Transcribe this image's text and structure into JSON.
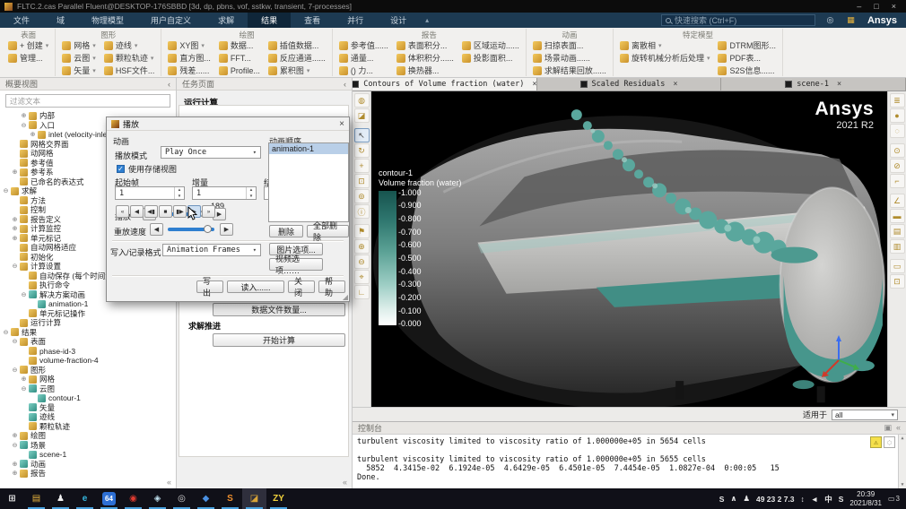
{
  "titlebar": {
    "title": "FLTC.2.cas Parallel Fluent@DESKTOP-176SBBD  [3d, dp, pbns, vof, sstkw, transient, 7-processes]",
    "minimize": "–",
    "maximize": "□",
    "close": "×"
  },
  "menubar": {
    "tabs": [
      {
        "label": "文件"
      },
      {
        "label": "域"
      },
      {
        "label": "物理模型"
      },
      {
        "label": "用户自定义"
      },
      {
        "label": "求解"
      },
      {
        "label": "结果",
        "active": true
      },
      {
        "label": "查看"
      },
      {
        "label": "并行"
      },
      {
        "label": "设计"
      }
    ],
    "collapse_icon": "▴",
    "search_placeholder": "快速搜索 (Ctrl+F)",
    "help_icon": "◎",
    "apps_icon": "▦",
    "brand": "Ansys"
  },
  "ribbon": {
    "groups": [
      {
        "title": "表面",
        "columns": [
          [
            {
              "label": "+ 创建",
              "icon": "create-surface",
              "caret": true
            },
            {
              "label": "管理...",
              "icon": "manage-surfaces"
            }
          ]
        ]
      },
      {
        "title": "图形",
        "columns": [
          [
            {
              "label": "网格",
              "icon": "mesh-display",
              "caret": true
            },
            {
              "label": "云图",
              "icon": "contours",
              "caret": true
            },
            {
              "label": "矢量",
              "icon": "vectors",
              "caret": true
            }
          ],
          [
            {
              "label": "迹线",
              "icon": "pathlines",
              "caret": true
            },
            {
              "label": "颗粒轨迹",
              "icon": "particle-tracks",
              "caret": true
            },
            {
              "label": "HSF文件...",
              "icon": "hsf-file"
            }
          ]
        ]
      },
      {
        "title": "绘图",
        "columns": [
          [
            {
              "label": "XY图",
              "icon": "xy-plot",
              "caret": true
            },
            {
              "label": "直方图...",
              "icon": "histogram"
            },
            {
              "label": "残差......",
              "icon": "residuals"
            }
          ],
          [
            {
              "label": "数据...",
              "icon": "data-sources"
            },
            {
              "label": "FFT...",
              "icon": "fft"
            },
            {
              "label": "Profile...",
              "icon": "profile-data"
            }
          ],
          [
            {
              "label": "插值数据...",
              "icon": "interpolated-data"
            },
            {
              "label": "反应通道......",
              "icon": "reaction-pathways"
            },
            {
              "label": "累积图",
              "icon": "cumulative-plot",
              "caret": true
            }
          ]
        ]
      },
      {
        "title": "报告",
        "columns": [
          [
            {
              "label": "参考值......",
              "icon": "reference-values"
            },
            {
              "label": "通量...",
              "icon": "fluxes"
            },
            {
              "label": "() 力...",
              "icon": "forces"
            }
          ],
          [
            {
              "label": "表面积分...",
              "icon": "surface-integrals"
            },
            {
              "label": "体积积分......",
              "icon": "volume-integrals"
            },
            {
              "label": "换热器...",
              "icon": "heat-exchanger"
            }
          ],
          [
            {
              "label": "区域运动......",
              "icon": "zone-motion"
            },
            {
              "label": "投影面积...",
              "icon": "projected-areas"
            }
          ]
        ]
      },
      {
        "title": "动画",
        "columns": [
          [
            {
              "label": "扫掠表面...",
              "icon": "sweep-surface"
            },
            {
              "label": "场景动画......",
              "icon": "scene-animation"
            },
            {
              "label": "求解结果回放......",
              "icon": "solution-playback"
            }
          ]
        ]
      },
      {
        "title": "特定模型",
        "columns": [
          [
            {
              "label": "离散相",
              "icon": "discrete-phase",
              "caret": true
            },
            {
              "label": "旋转机械分析后处理",
              "icon": "turbo-postprocessing",
              "caret": true
            }
          ],
          [
            {
              "label": "DTRM图形...",
              "icon": "dtrm-graphics"
            },
            {
              "label": "PDF表...",
              "icon": "pdf-tables"
            },
            {
              "label": "S2S信息......",
              "icon": "s2s-info"
            }
          ]
        ]
      }
    ]
  },
  "outline": {
    "header": "概要视图",
    "collapse": "‹",
    "filter_placeholder": "过滤文本",
    "scroll_hint": "«",
    "items": [
      {
        "label": "内部",
        "depth": 2,
        "expand": "+",
        "icon": "internal-zone"
      },
      {
        "label": "入口",
        "depth": 2,
        "expand": "-",
        "icon": "inlet-zone"
      },
      {
        "label": "inlet (velocity-inlet...",
        "depth": 3,
        "expand": "+",
        "icon": "velocity-inlet"
      },
      {
        "label": "网格交界面",
        "depth": 1,
        "expand": "",
        "icon": "mesh-interfaces"
      },
      {
        "label": "动网格",
        "depth": 1,
        "expand": "",
        "icon": "dynamic-mesh"
      },
      {
        "label": "参考值",
        "depth": 1,
        "expand": "",
        "icon": "reference-values"
      },
      {
        "label": "参考系",
        "depth": 1,
        "expand": "+",
        "icon": "reference-frames"
      },
      {
        "label": "已命名的表达式",
        "depth": 1,
        "expand": "",
        "icon": "named-expressions"
      },
      {
        "label": "求解",
        "depth": 0,
        "expand": "-",
        "icon": "solution"
      },
      {
        "label": "方法",
        "depth": 1,
        "expand": "",
        "icon": "methods"
      },
      {
        "label": "控制",
        "depth": 1,
        "expand": "",
        "icon": "controls"
      },
      {
        "label": "报告定义",
        "depth": 1,
        "expand": "+",
        "icon": "report-definitions"
      },
      {
        "label": "计算监控",
        "depth": 1,
        "expand": "+",
        "icon": "monitors"
      },
      {
        "label": "单元标记",
        "depth": 1,
        "expand": "+",
        "icon": "cell-registers"
      },
      {
        "label": "自动网格适应",
        "depth": 1,
        "expand": "",
        "icon": "mesh-adaption"
      },
      {
        "label": "初始化",
        "depth": 1,
        "expand": "",
        "icon": "initialization"
      },
      {
        "label": "计算设置",
        "depth": 1,
        "expand": "-",
        "icon": "calculation-activities"
      },
      {
        "label": "自动保存 (每个时间步)",
        "depth": 2,
        "expand": "",
        "icon": "autosave"
      },
      {
        "label": "执行命令",
        "depth": 2,
        "expand": "",
        "icon": "execute-commands"
      },
      {
        "label": "解决方案动画",
        "depth": 2,
        "expand": "-",
        "icon": "solution-animations"
      },
      {
        "label": "animation-1",
        "depth": 3,
        "expand": "",
        "icon": "animation-item"
      },
      {
        "label": "单元标记操作",
        "depth": 2,
        "expand": "",
        "icon": "register-operations"
      },
      {
        "label": "运行计算",
        "depth": 1,
        "expand": "",
        "icon": "run-calculation"
      },
      {
        "label": "结果",
        "depth": 0,
        "expand": "-",
        "icon": "results"
      },
      {
        "label": "表面",
        "depth": 1,
        "expand": "-",
        "icon": "surfaces"
      },
      {
        "label": "phase-id-3",
        "depth": 2,
        "expand": "",
        "icon": "surface-item"
      },
      {
        "label": "volume-fraction-4",
        "depth": 2,
        "expand": "",
        "icon": "surface-item"
      },
      {
        "label": "图形",
        "depth": 1,
        "expand": "-",
        "icon": "graphics-node"
      },
      {
        "label": "网格",
        "depth": 2,
        "expand": "+",
        "icon": "mesh-graphic"
      },
      {
        "label": "云图",
        "depth": 2,
        "expand": "-",
        "icon": "contours-node"
      },
      {
        "label": "contour-1",
        "depth": 3,
        "expand": "",
        "icon": "contour-item"
      },
      {
        "label": "矢量",
        "depth": 2,
        "expand": "",
        "icon": "vectors-node"
      },
      {
        "label": "迹线",
        "depth": 2,
        "expand": "",
        "icon": "pathlines-node"
      },
      {
        "label": "颗粒轨迹",
        "depth": 2,
        "expand": "",
        "icon": "particle-tracks-node"
      },
      {
        "label": "绘图",
        "depth": 1,
        "expand": "+",
        "icon": "plots-node"
      },
      {
        "label": "场景",
        "depth": 1,
        "expand": "-",
        "icon": "scenes-node"
      },
      {
        "label": "scene-1",
        "depth": 2,
        "expand": "",
        "icon": "scene-item"
      },
      {
        "label": "动画",
        "depth": 1,
        "expand": "+",
        "icon": "animations-node"
      },
      {
        "label": "报告",
        "depth": 1,
        "expand": "+",
        "icon": "reports-node"
      }
    ]
  },
  "taskpage": {
    "header": "任务页面",
    "collapse": "‹",
    "title": "运行计算",
    "data_file_button": "数据文件数量...",
    "advance_label": "求解推进",
    "calculate_button": "开始计算",
    "scroll_hint": "«"
  },
  "dialog": {
    "title": "播放",
    "close": "×",
    "section_animation": "动画",
    "playback_mode_label": "播放模式",
    "playback_mode_value": "Play Once",
    "use_stored_view": "使用存储视图",
    "check_glyph": "✓",
    "start_frame_label": "起始帧",
    "start_frame_value": "1",
    "increment_label": "增量",
    "increment_value": "1",
    "end_frame_label": "结束帧",
    "end_frame_value": "189",
    "play_label": "播放",
    "frame_value": "189",
    "slider_left": "◀",
    "slider_right": "▶",
    "transport": [
      {
        "name": "first-frame-button",
        "glyph": "«"
      },
      {
        "name": "play-reverse-button",
        "glyph": "◀"
      },
      {
        "name": "step-back-button",
        "glyph": "◀▮"
      },
      {
        "name": "stop-button",
        "glyph": "■"
      },
      {
        "name": "step-forward-button",
        "glyph": "▮▶"
      },
      {
        "name": "play-button",
        "glyph": "▶",
        "active": true
      },
      {
        "name": "last-frame-button",
        "glyph": "»"
      }
    ],
    "replay_speed_label": "重放速度",
    "write_format_label": "写入/记录格式",
    "write_format_value": "Animation Frames",
    "picture_options": "图片选项...",
    "video_options": "视频选项……",
    "sequences_label": "动画顺序",
    "sequences": [
      {
        "label": "animation-1",
        "active": true
      }
    ],
    "delete": "删除",
    "delete_all": "全部删除",
    "write": "写出",
    "read": "读入......",
    "close_btn": "关闭",
    "help": "帮助",
    "grip": "◢"
  },
  "graphics": {
    "tabs": [
      {
        "label": "Contours of Volume fraction (water)",
        "close": "×",
        "active": true
      },
      {
        "label": "Scaled Residuals",
        "close": "×"
      },
      {
        "label": "scene-1",
        "close": "×"
      }
    ],
    "left_toolbar": [
      {
        "name": "mesh-display-button",
        "glyph": "◍"
      },
      {
        "name": "clip-plane-button",
        "glyph": "◪"
      },
      {
        "name": "pointer-tool-button",
        "glyph": "↖",
        "active": true,
        "gap": true
      },
      {
        "name": "rotate-tool-button",
        "glyph": "↻"
      },
      {
        "name": "pan-tool-button",
        "glyph": "+"
      },
      {
        "name": "zoom-box-tool-button",
        "glyph": "⊡"
      },
      {
        "name": "probe-tool-button",
        "glyph": "⊚"
      },
      {
        "name": "info-button",
        "glyph": "ⓘ"
      },
      {
        "name": "render-button",
        "glyph": "⚑",
        "gap": true
      },
      {
        "name": "zoom-in-button",
        "glyph": "⊕"
      },
      {
        "name": "zoom-out-button",
        "glyph": "⊖"
      },
      {
        "name": "fit-view-button",
        "glyph": "⌖"
      },
      {
        "name": "axes-button",
        "glyph": "∟"
      }
    ],
    "right_toolbar": [
      {
        "name": "view-layers-button",
        "glyph": "≣"
      },
      {
        "name": "shaded-view-button",
        "glyph": "●"
      },
      {
        "name": "wireframe-view-button",
        "glyph": "◌"
      },
      {
        "name": "show-items-button",
        "glyph": "⊙",
        "gap": true
      },
      {
        "name": "hide-items-button",
        "glyph": "⊘"
      },
      {
        "name": "previous-view-button",
        "glyph": "⌐"
      },
      {
        "name": "axes-plot-button",
        "glyph": "∠",
        "gap": true
      },
      {
        "name": "highlight-button",
        "glyph": "▬"
      },
      {
        "name": "annotate-button",
        "glyph": "▤"
      },
      {
        "name": "report-view-button",
        "glyph": "▥"
      },
      {
        "name": "new-window-button",
        "glyph": "▭",
        "gap": true
      },
      {
        "name": "embedded-window-button",
        "glyph": "⊡"
      }
    ],
    "legend": {
      "name": "contour-1",
      "title": "Volume fraction (water)",
      "ticks": [
        "1.000",
        "0.900",
        "0.800",
        "0.700",
        "0.600",
        "0.500",
        "0.400",
        "0.300",
        "0.200",
        "0.100",
        "0.000"
      ]
    },
    "brand": {
      "name": "Ansys",
      "version": "2021 R2"
    },
    "apply_label": "适用于",
    "apply_value": "all",
    "apply_caret": "▾"
  },
  "console": {
    "title": "控制台",
    "float_icon": "▣",
    "collapse_icon": "«",
    "warn_icon": "⚠",
    "status_icon": "◌",
    "scroll_up": "▲",
    "scroll_down": "▼",
    "lines": [
      "turbulent viscosity limited to viscosity ratio of 1.000000e+05 in 5654 cells",
      "",
      "turbulent viscosity limited to viscosity ratio of 1.000000e+05 in 5655 cells",
      "  5852  4.3415e-02  6.1924e-05  4.6429e-05  6.4501e-05  7.4454e-05  1.0827e-04  0:00:05   15",
      "Done."
    ]
  },
  "taskbar": {
    "apps": [
      {
        "name": "start-button",
        "glyph": "⊞",
        "color": "#e6e6e6"
      },
      {
        "name": "file-explorer-icon",
        "glyph": "▤",
        "color": "#e8b43d",
        "open": true
      },
      {
        "name": "qq-icon",
        "glyph": "♟",
        "color": "#f0f0f0",
        "open": true
      },
      {
        "name": "edge-icon",
        "glyph": "e",
        "color": "#35b8e0",
        "open": true
      },
      {
        "name": "browser-64-icon",
        "glyph": "64",
        "bg": "#2d6fd4",
        "color": "#fff",
        "open": true
      },
      {
        "name": "recorder-icon",
        "glyph": "◉",
        "color": "#e03b30",
        "open": true
      },
      {
        "name": "media-viewer-icon",
        "glyph": "◈",
        "color": "#bfe0ee",
        "open": true
      },
      {
        "name": "capture-icon",
        "glyph": "◎",
        "color": "#d8d8d8",
        "open": true
      },
      {
        "name": "netdisk-icon",
        "glyph": "◆",
        "color": "#4a90e2",
        "open": true
      },
      {
        "name": "editor-icon",
        "glyph": "S",
        "color": "#ef8f2e",
        "open": true
      },
      {
        "name": "fluent-taskbar-icon",
        "glyph": "◪",
        "color": "#d9a437",
        "open": true,
        "active": true
      },
      {
        "name": "zy-icon",
        "glyph": "ZY",
        "color": "#f2d23c",
        "open": true
      }
    ],
    "tray": [
      {
        "name": "sogou-tray-icon",
        "glyph": "S",
        "color": "#e8452c"
      },
      {
        "name": "tray-expand-icon",
        "glyph": "∧",
        "color": "#cfcfcf"
      },
      {
        "name": "pet-tray-icon",
        "glyph": "♟",
        "color": "#e570a8"
      },
      {
        "name": "monitor-values",
        "glyph": "49 23 2 7.3",
        "color": "#e8e8e8"
      },
      {
        "name": "network-icon",
        "glyph": "↕",
        "color": "#cfcfcf"
      },
      {
        "name": "volume-icon",
        "glyph": "◄",
        "color": "#cfcfcf"
      },
      {
        "name": "ime-icon",
        "glyph": "中",
        "color": "#f0f0f0"
      },
      {
        "name": "sogou2-tray-icon",
        "glyph": "S",
        "color": "#e8452c"
      }
    ],
    "clock": {
      "time": "20:39",
      "date": "2021/8/31"
    },
    "notif_icon": "▭",
    "notif_badge": "3"
  }
}
